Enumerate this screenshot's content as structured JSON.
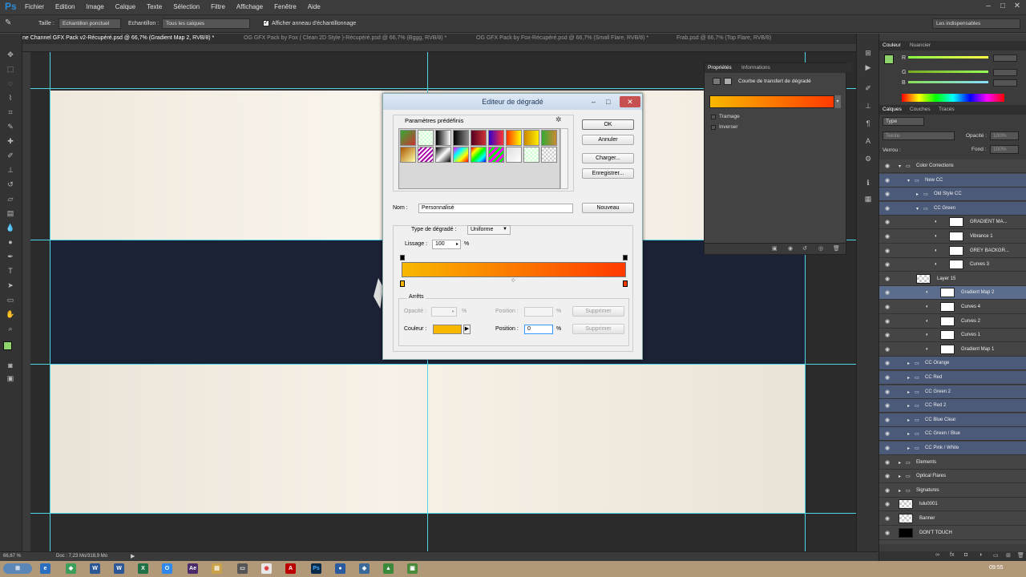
{
  "app": {
    "logo": "Ps"
  },
  "menu": [
    "Fichier",
    "Edition",
    "Image",
    "Calque",
    "Texte",
    "Sélection",
    "Filtre",
    "Affichage",
    "Fenêtre",
    "Aide"
  ],
  "options": {
    "taille_label": "Taille :",
    "taille_value": "Echantillon ponctuel",
    "echantillon_label": "Echantillon :",
    "echantillon_value": "Tous les calques",
    "show_ring": "Afficher anneau d'échantillonnage",
    "workspace": "Les indispensables"
  },
  "tabs": [
    "ne Channel GFX Pack v2-Récupéré.psd @ 66,7% (Gradient Map 2, RVB/8) *",
    "OG GFX Pack by Fox ( Clean 2D Style )-Récupéré.psd @ 66,7% (Bggg, RVB/8) *",
    "OG GFX Pack by Fox-Récupéré.psd @ 66,7% (Small Flare, RVB/8) *",
    "Frab.psd @ 66,7% (Top Flare, RVB/8)"
  ],
  "status": {
    "zoom": "66,67 %",
    "doc": "Doc : 7,23 Mo/318,9 Mo"
  },
  "properties": {
    "tab1": "Propriétés",
    "tab2": "Informations",
    "title": "Courbe de transfert de dégradé",
    "tramage": "Tramage",
    "inverser": "Inverser"
  },
  "color_panel": {
    "tab1": "Couleur",
    "tab2": "Nuancier",
    "r": "R",
    "g": "G",
    "b": "B"
  },
  "layers_panel": {
    "tab1": "Calques",
    "tab2": "Couches",
    "tab3": "Tracés",
    "kind": "Type",
    "blend": "Teinte",
    "opacity_label": "Opacité :",
    "opacity_value": "100%",
    "lock_label": "Verrou :",
    "fill_label": "Fond :",
    "fill_value": "100%"
  },
  "layers": [
    {
      "name": "Color Corrections",
      "indent": 0,
      "type": "group-open"
    },
    {
      "name": "New CC",
      "indent": 1,
      "type": "group-open"
    },
    {
      "name": "Old Style CC",
      "indent": 2,
      "type": "group"
    },
    {
      "name": "CC Green",
      "indent": 2,
      "type": "group-open"
    },
    {
      "name": "GRADIENT MA...",
      "indent": 3,
      "type": "adj"
    },
    {
      "name": "Vibrance 1",
      "indent": 3,
      "type": "adj"
    },
    {
      "name": "GREY BACKGR...",
      "indent": 3,
      "type": "adj"
    },
    {
      "name": "Curves 3",
      "indent": 3,
      "type": "adj"
    },
    {
      "name": "Layer 15",
      "indent": 2,
      "type": "pixel"
    },
    {
      "name": "Gradient Map 2",
      "indent": 2,
      "type": "adj",
      "selected": true
    },
    {
      "name": "Curves 4",
      "indent": 2,
      "type": "adj"
    },
    {
      "name": "Curves 2",
      "indent": 2,
      "type": "adj"
    },
    {
      "name": "Curves 1",
      "indent": 2,
      "type": "adj"
    },
    {
      "name": "Gradient Map 1",
      "indent": 2,
      "type": "adj"
    },
    {
      "name": "CC Orange",
      "indent": 1,
      "type": "group"
    },
    {
      "name": "CC Red",
      "indent": 1,
      "type": "group"
    },
    {
      "name": "CC Green 2",
      "indent": 1,
      "type": "group"
    },
    {
      "name": "CC Red 2",
      "indent": 1,
      "type": "group"
    },
    {
      "name": "CC Blue Clear",
      "indent": 1,
      "type": "group"
    },
    {
      "name": "CC Green / Blue",
      "indent": 1,
      "type": "group"
    },
    {
      "name": "CC Pink / White",
      "indent": 1,
      "type": "group"
    },
    {
      "name": "Elements",
      "indent": 0,
      "type": "group"
    },
    {
      "name": "Optical Flares",
      "indent": 0,
      "type": "group"
    },
    {
      "name": "Signatures",
      "indent": 0,
      "type": "group"
    },
    {
      "name": "lulu0001",
      "indent": 0,
      "type": "pixel"
    },
    {
      "name": "Banner",
      "indent": 0,
      "type": "pixel"
    },
    {
      "name": "DON'T TOUCH",
      "indent": 0,
      "type": "pixel"
    }
  ],
  "dialog": {
    "title": "Editeur de dégradé",
    "presets_label": "Paramètres prédéfinis",
    "ok": "OK",
    "cancel": "Annuler",
    "load": "Charger...",
    "save": "Enregistrer...",
    "name_label": "Nom :",
    "name_value": "Personnalisé",
    "new": "Nouveau",
    "type_label": "Type de dégradé :",
    "type_value": "Uniforme",
    "smooth_label": "Lissage :",
    "smooth_value": "100",
    "percent": "%",
    "stops_label": "Arrêts",
    "opacity_label": "Opacité :",
    "position_label": "Position :",
    "delete": "Supprimer",
    "color_label": "Couleur :",
    "position_value": "0",
    "color_start": "#f8b800",
    "color_end": "#ff3a00"
  },
  "taskbar": {
    "time": "09:55"
  }
}
